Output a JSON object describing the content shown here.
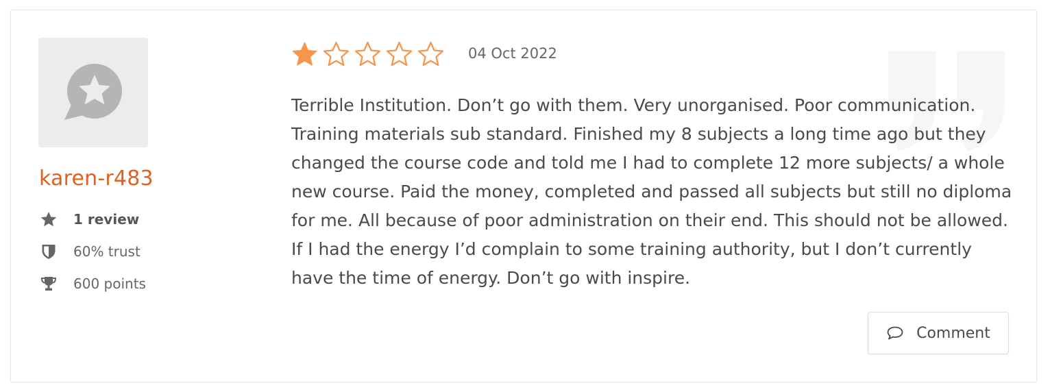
{
  "reviewer": {
    "username": "karen-r483",
    "avatar_icon": "star-speech-bubble-icon",
    "stats": [
      {
        "icon": "star-icon",
        "label": "1 review"
      },
      {
        "icon": "shield-icon",
        "label": "60% trust"
      },
      {
        "icon": "trophy-icon",
        "label": "600 points"
      }
    ]
  },
  "review": {
    "rating": 1,
    "max_rating": 5,
    "date": "04 Oct 2022",
    "text": "Terrible Institution. Don’t go with them. Very unorganised. Poor communication. Training materials sub standard. Finished my 8 subjects a long time ago but they changed the course code and told me I had to complete 12 more subjects/ a whole new course. Paid the money, completed and passed all subjects but still no diploma for me. All because of poor administration on their end. This should not be allowed. If I had the energy I’d complain to some training authority, but I don’t currently have the time of energy. Don’t go with inspire."
  },
  "actions": {
    "comment_label": "Comment",
    "comment_icon": "speech-bubble-icon"
  },
  "colors": {
    "accent": "#e0611f",
    "star": "#f7954a",
    "stat_icon": "#666666"
  }
}
